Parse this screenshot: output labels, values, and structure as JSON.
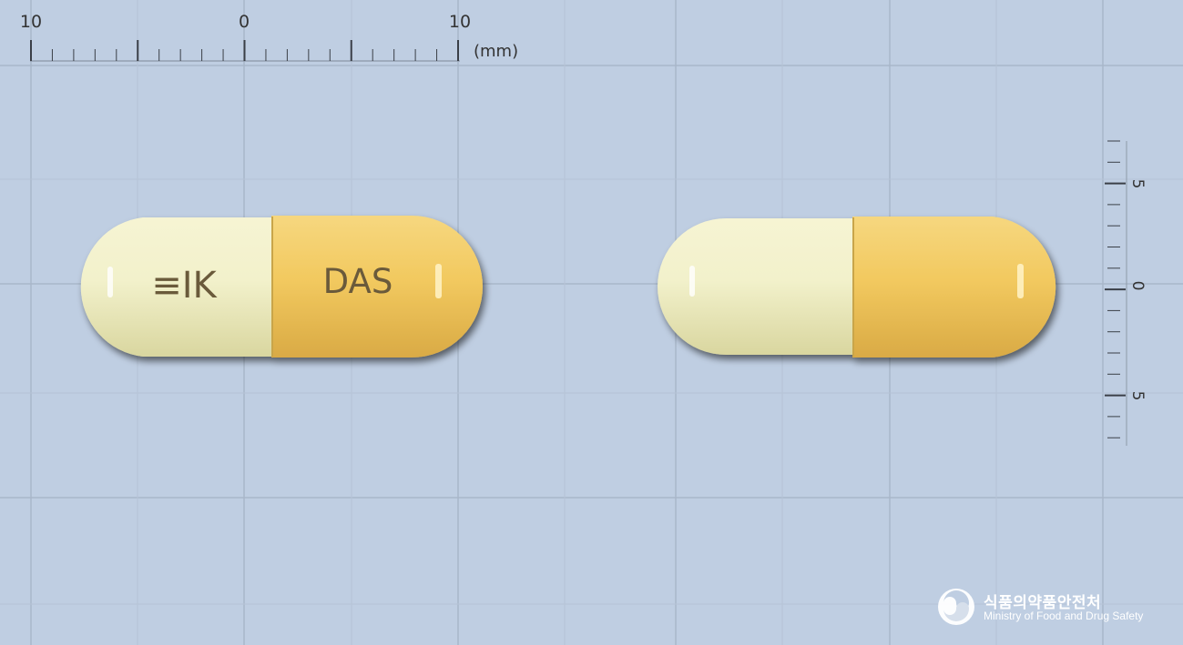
{
  "ruler_top": {
    "labels": [
      "10",
      "0",
      "10"
    ],
    "unit": "(mm)"
  },
  "ruler_right": {
    "labels": [
      "5",
      "0",
      "5"
    ]
  },
  "capsule_front": {
    "left_imprint": "≡IK",
    "right_imprint": "DAS"
  },
  "watermark": {
    "korean": "식품의약품안전처",
    "english": "Ministry of Food and Drug Safety"
  },
  "colors": {
    "background": "#bfcee2",
    "grid": "#a9b7c9",
    "capsule_cream": "#f1f0c6",
    "capsule_yellow": "#f2c95f",
    "imprint": "#6a5a3a"
  }
}
